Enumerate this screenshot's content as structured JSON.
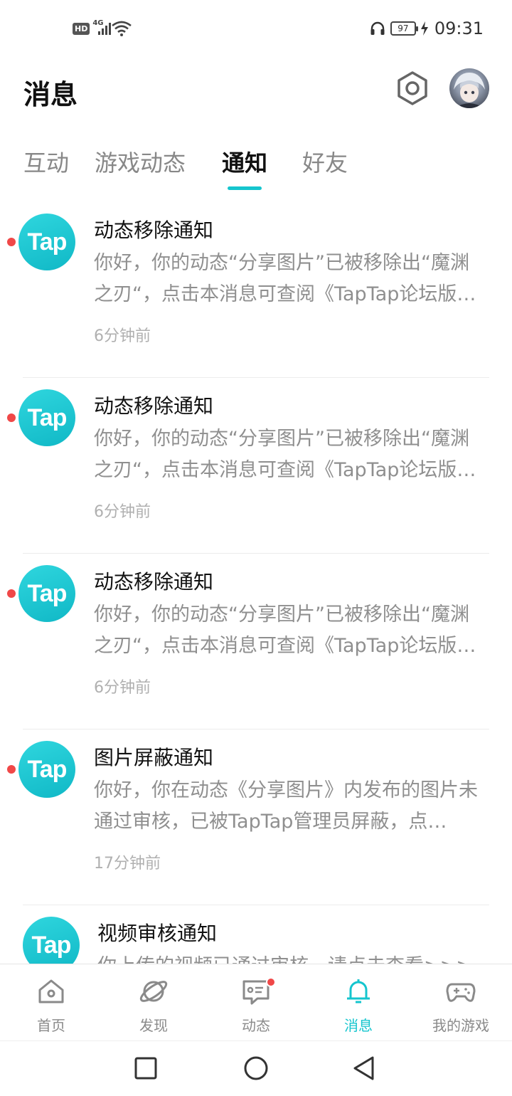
{
  "status_bar": {
    "hd": "HD",
    "network": "4G",
    "battery": "97",
    "time": "09:31",
    "icons": [
      "hd-badge",
      "signal-icon",
      "wifi-icon",
      "headphone-icon",
      "battery-icon",
      "charging-icon"
    ]
  },
  "header": {
    "title": "消息",
    "settings_icon": "hexagon-settings-icon",
    "avatar": "user-avatar"
  },
  "tabs": [
    {
      "label": "互动",
      "active": false
    },
    {
      "label": "游戏动态",
      "active": false
    },
    {
      "label": "通知",
      "active": true
    },
    {
      "label": "好友",
      "active": false
    }
  ],
  "messages": [
    {
      "logo": "Tap",
      "title": "动态移除通知",
      "body": "你好，你的动态“分享图片”已被移除出“魔渊之刃“，点击本消息可查阅《TapTap论坛版…",
      "time": "6分钟前",
      "unread": true
    },
    {
      "logo": "Tap",
      "title": "动态移除通知",
      "body": "你好，你的动态“分享图片”已被移除出“魔渊之刃“，点击本消息可查阅《TapTap论坛版…",
      "time": "6分钟前",
      "unread": true
    },
    {
      "logo": "Tap",
      "title": "动态移除通知",
      "body": "你好，你的动态“分享图片”已被移除出“魔渊之刃“，点击本消息可查阅《TapTap论坛版…",
      "time": "6分钟前",
      "unread": true
    },
    {
      "logo": "Tap",
      "title": "图片屏蔽通知",
      "body": "你好，你在动态《分享图片》内发布的图片未通过审核，已被TapTap管理员屏蔽，点…",
      "time": "17分钟前",
      "unread": true
    },
    {
      "logo": "Tap",
      "title": "视频审核通知",
      "body": "你上传的视频已通过审核，请点击查看>>>",
      "time": "",
      "unread": false
    }
  ],
  "bottom_nav": [
    {
      "label": "首页",
      "icon": "home-icon",
      "active": false,
      "badge": false
    },
    {
      "label": "发现",
      "icon": "planet-icon",
      "active": false,
      "badge": false
    },
    {
      "label": "动态",
      "icon": "chat-card-icon",
      "active": false,
      "badge": true
    },
    {
      "label": "消息",
      "icon": "bell-icon",
      "active": true,
      "badge": false
    },
    {
      "label": "我的游戏",
      "icon": "gamepad-icon",
      "active": false,
      "badge": false
    }
  ],
  "system_nav": [
    "recents-square-icon",
    "home-circle-icon",
    "back-triangle-icon"
  ],
  "colors": {
    "accent": "#15c5ce",
    "unread": "#f04848",
    "muted_text": "#8f8f8f"
  }
}
